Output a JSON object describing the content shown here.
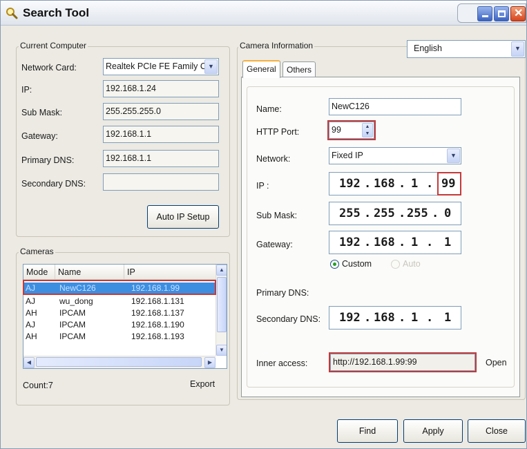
{
  "window": {
    "title": "Search Tool"
  },
  "current_computer": {
    "legend": "Current Computer",
    "network_card_label": "Network Card:",
    "network_card_value": "Realtek PCIe FE Family C",
    "ip_label": "IP:",
    "ip_value": "192.168.1.24",
    "sub_mask_label": "Sub Mask:",
    "sub_mask_value": "255.255.255.0",
    "gateway_label": "Gateway:",
    "gateway_value": "192.168.1.1",
    "primary_dns_label": "Primary DNS:",
    "primary_dns_value": "192.168.1.1",
    "secondary_dns_label": "Secondary DNS:",
    "secondary_dns_value": "",
    "auto_ip_button": "Auto IP Setup"
  },
  "cameras": {
    "legend": "Cameras",
    "columns": [
      "Mode",
      "Name",
      "IP"
    ],
    "rows": [
      {
        "mode": "AJ",
        "name": "NewC126",
        "ip": "192.168.1.99",
        "selected": true
      },
      {
        "mode": "AJ",
        "name": "wu_dong",
        "ip": "192.168.1.131"
      },
      {
        "mode": "AH",
        "name": "IPCAM",
        "ip": "192.168.1.137"
      },
      {
        "mode": "AJ",
        "name": "IPCAM",
        "ip": "192.168.1.190"
      },
      {
        "mode": "AH",
        "name": "IPCAM",
        "ip": "192.168.1.193"
      }
    ],
    "count_label": "Count:7",
    "export_label": "Export"
  },
  "camera_info": {
    "legend": "Camera Information",
    "language": "English",
    "tabs": [
      "General",
      "Others"
    ],
    "name_label": "Name:",
    "name_value": "NewC126",
    "http_port_label": "HTTP Port:",
    "http_port_value": "99",
    "network_label": "Network:",
    "network_value": "Fixed IP",
    "ip_label": "IP :",
    "ip_octets": [
      "192",
      "168",
      "1",
      "99"
    ],
    "sub_mask_label": "Sub Mask:",
    "sub_mask_octets": [
      "255",
      "255",
      "255",
      "0"
    ],
    "gateway_label": "Gateway:",
    "gateway_octets": [
      "192",
      "168",
      "1",
      "1"
    ],
    "custom_label": "Custom",
    "auto_label": "Auto",
    "primary_dns_label": "Primary DNS:",
    "secondary_dns_label": "Secondary DNS:",
    "secondary_dns_octets": [
      "192",
      "168",
      "1",
      "1"
    ],
    "inner_access_label": "Inner access:",
    "inner_access_value": "http://192.168.1.99:99",
    "open_label": "Open"
  },
  "buttons": {
    "find": "Find",
    "apply": "Apply",
    "close": "Close"
  },
  "colors": {
    "highlight": "#c33a3a",
    "selection": "#3d8ee0",
    "title_close": "#d8451d"
  }
}
